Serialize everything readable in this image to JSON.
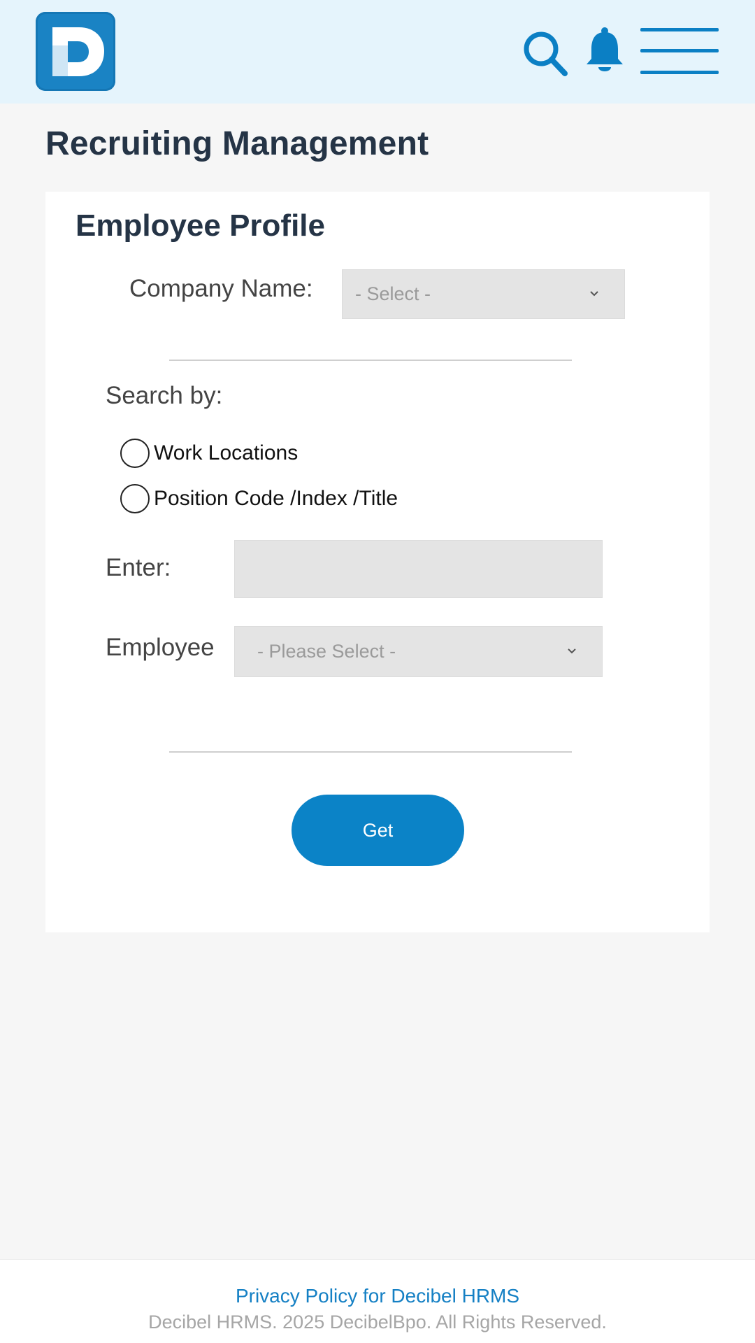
{
  "header": {
    "logo_icon": "decibel-d-logo",
    "icons": [
      "search-icon",
      "bell-icon",
      "menu-icon"
    ],
    "accent_color": "#0b7fc4"
  },
  "page": {
    "title": "Recruiting Management"
  },
  "card": {
    "title": "Employee Profile",
    "company_label": "Company Name:",
    "company_select_value": "- Select -",
    "search_by_label": "Search by:",
    "radio_options": [
      "Work Locations",
      "Position Code /Index /Title"
    ],
    "enter_label": "Enter:",
    "enter_value": "",
    "employee_label": "Employee",
    "employee_select_value": "- Please Select -",
    "get_button": "Get"
  },
  "footer": {
    "privacy_link": "Privacy Policy for Decibel HRMS",
    "copyright": "Decibel HRMS. 2025 DecibelBpo. All Rights Reserved."
  }
}
